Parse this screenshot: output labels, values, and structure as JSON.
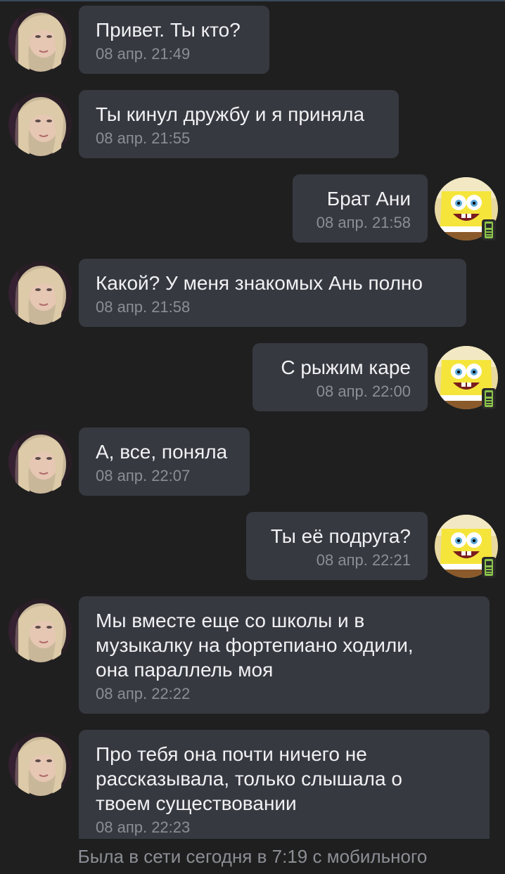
{
  "conversation": {
    "messages": [
      {
        "direction": "in",
        "text": "Привет. Ты кто?",
        "time": "08 апр. 21:49"
      },
      {
        "direction": "in",
        "text": "Ты кинул дружбу и я приняла",
        "time": "08 апр. 21:55"
      },
      {
        "direction": "out",
        "text": "Брат Ани",
        "time": "08 апр. 21:58"
      },
      {
        "direction": "in",
        "text": "Какой? У меня знакомых Ань полно",
        "time": "08 апр. 21:58"
      },
      {
        "direction": "out",
        "text": "С рыжим каре",
        "time": "08 апр. 22:00"
      },
      {
        "direction": "in",
        "text": "А, все, поняла",
        "time": "08 апр. 22:07"
      },
      {
        "direction": "out",
        "text": "Ты её подруга?",
        "time": "08 апр. 22:21"
      },
      {
        "direction": "in",
        "text": "Мы вместе еще со школы и в\nмузыкалку на фортепиано ходили,\nона параллель моя",
        "time": "08 апр. 22:22"
      },
      {
        "direction": "in",
        "text": "Про тебя она почти ничего не\nрассказывала, только слышала о\nтвоем существовании",
        "time": "08 апр. 22:23"
      }
    ]
  },
  "avatars": {
    "incoming": "girl-avatar",
    "outgoing": "spongebob-avatar",
    "online_indicator": "mobile-phone-icon"
  },
  "status_bar": {
    "text": "Была в сети сегодня в 7:19 с мобильного"
  },
  "colors": {
    "background": "#1f1f1f",
    "bubble": "#373941",
    "text": "#f1f1f3",
    "time": "#8c8e95",
    "online_mobile": "#8bc34a"
  }
}
